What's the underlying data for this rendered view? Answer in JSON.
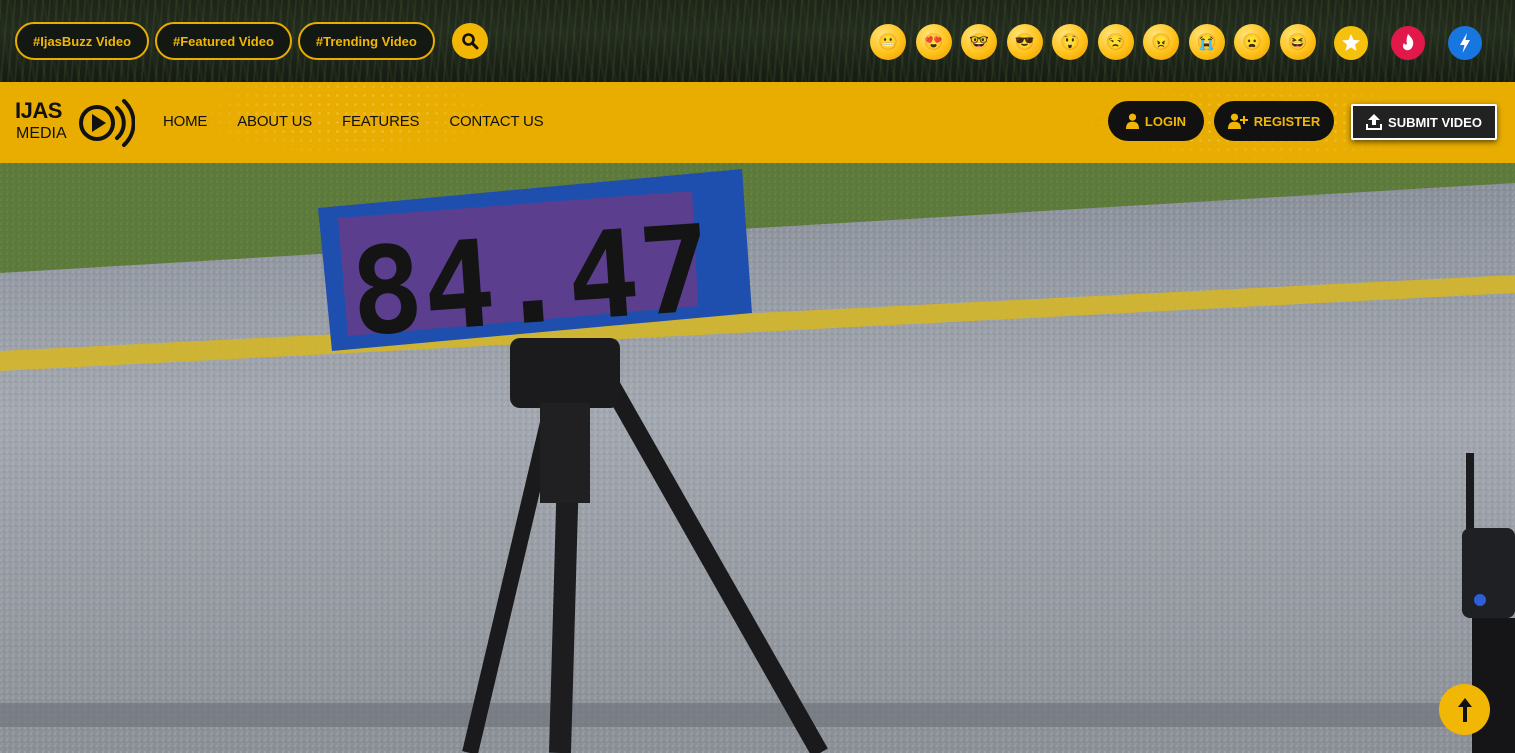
{
  "topbar": {
    "tags": [
      "#IjasBuzz Video",
      "#Featured Video",
      "#Trending Video"
    ],
    "search_icon": "search-icon",
    "emojis": [
      {
        "name": "grimace-emoji-icon",
        "glyph": "😬"
      },
      {
        "name": "heart-eyes-emoji-icon",
        "glyph": "😍"
      },
      {
        "name": "nerd-emoji-icon",
        "glyph": "🤓"
      },
      {
        "name": "sunglasses-emoji-icon",
        "glyph": "😎"
      },
      {
        "name": "surprised-emoji-icon",
        "glyph": "😲"
      },
      {
        "name": "unamused-emoji-icon",
        "glyph": "😒"
      },
      {
        "name": "angry-emoji-icon",
        "glyph": "😠"
      },
      {
        "name": "crying-emoji-icon",
        "glyph": "😭"
      },
      {
        "name": "frowning-emoji-icon",
        "glyph": "😦"
      },
      {
        "name": "laughing-emoji-icon",
        "glyph": "😆"
      }
    ],
    "badges": [
      {
        "name": "star-icon",
        "color": "#f5c10c"
      },
      {
        "name": "flame-icon",
        "color": "#e2184a"
      },
      {
        "name": "lightning-icon",
        "color": "#1876e0"
      }
    ]
  },
  "brand": {
    "line1": "IJAS",
    "line2": "MEDIA"
  },
  "nav": {
    "items": [
      "HOME",
      "ABOUT US",
      "FEATURES",
      "CONTACT US"
    ]
  },
  "auth": {
    "login_label": "LOGIN",
    "register_label": "REGISTER",
    "submit_label": "SUBMIT VIDEO"
  },
  "hero": {
    "display_reading": "84.47"
  },
  "colors": {
    "accent": "#e8ad00",
    "accent_light": "#f2b705",
    "dark": "#111111"
  }
}
